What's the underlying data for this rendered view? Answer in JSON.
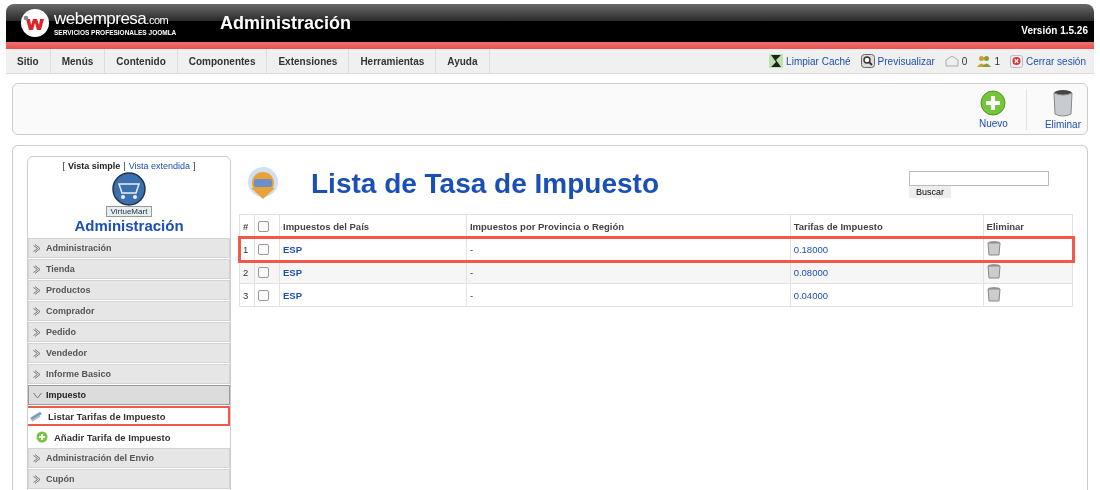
{
  "header": {
    "logo_name": "webempresa",
    "logo_suffix": ".com",
    "tagline": "SERVICIOS PROFESIONALES JOOMLA",
    "title": "Administración",
    "version": "Versión 1.5.26"
  },
  "menu": [
    {
      "label": "Sitio"
    },
    {
      "label": "Menús"
    },
    {
      "label": "Contenido"
    },
    {
      "label": "Componentes"
    },
    {
      "label": "Extensiones"
    },
    {
      "label": "Herramientas"
    },
    {
      "label": "Ayuda"
    }
  ],
  "status_links": [
    {
      "kind": "clear-cache",
      "label": "Limpiar Caché"
    },
    {
      "kind": "preview",
      "label": "Previsualizar"
    },
    {
      "kind": "messages",
      "label": "0"
    },
    {
      "kind": "users",
      "label": "1"
    },
    {
      "kind": "logout",
      "label": "Cerrar sesión"
    }
  ],
  "toolbar": [
    {
      "kind": "new",
      "label": "Nuevo"
    },
    {
      "kind": "delete",
      "label": "Eliminar"
    }
  ],
  "sidebar": {
    "view_open": "[",
    "view_separator": "|",
    "view_close": "]",
    "views": [
      {
        "label": "Vista simple",
        "selected": true
      },
      {
        "label": "Vista extendida",
        "selected": false
      }
    ],
    "brand": "VirtueMart",
    "heading": "Administración",
    "items": [
      {
        "label": "Administración",
        "expanded": false
      },
      {
        "label": "Tienda",
        "expanded": false
      },
      {
        "label": "Productos",
        "expanded": false
      },
      {
        "label": "Comprador",
        "expanded": false
      },
      {
        "label": "Pedido",
        "expanded": false
      },
      {
        "label": "Vendedor",
        "expanded": false
      },
      {
        "label": "Informe Basico",
        "expanded": false
      },
      {
        "label": "Impuesto",
        "expanded": true,
        "children": [
          {
            "kind": "list",
            "label": "Listar Tarifas de Impuesto",
            "highlighted": true
          },
          {
            "kind": "add",
            "label": "Añadir Tarifa de Impuesto",
            "highlighted": false
          }
        ]
      },
      {
        "label": "Administración del Envio",
        "expanded": false
      },
      {
        "label": "Cupón",
        "expanded": false
      }
    ]
  },
  "main": {
    "title": "Lista de Tasa de Impuesto",
    "search": {
      "button": "Buscar"
    },
    "table": {
      "select_all_checked": false,
      "columns": [
        "#",
        "Impuestos del País",
        "Impuestos por Provincia o Región",
        "Tarifas de Impuesto",
        "Eliminar"
      ],
      "rows": [
        {
          "number": "1",
          "checked": false,
          "country": "ESP",
          "region": "-",
          "rate": "0.18000",
          "highlighted": true
        },
        {
          "number": "2",
          "checked": false,
          "country": "ESP",
          "region": "-",
          "rate": "0.08000",
          "highlighted": false
        },
        {
          "number": "3",
          "checked": false,
          "country": "ESP",
          "region": "-",
          "rate": "0.04000",
          "highlighted": false
        }
      ]
    }
  }
}
